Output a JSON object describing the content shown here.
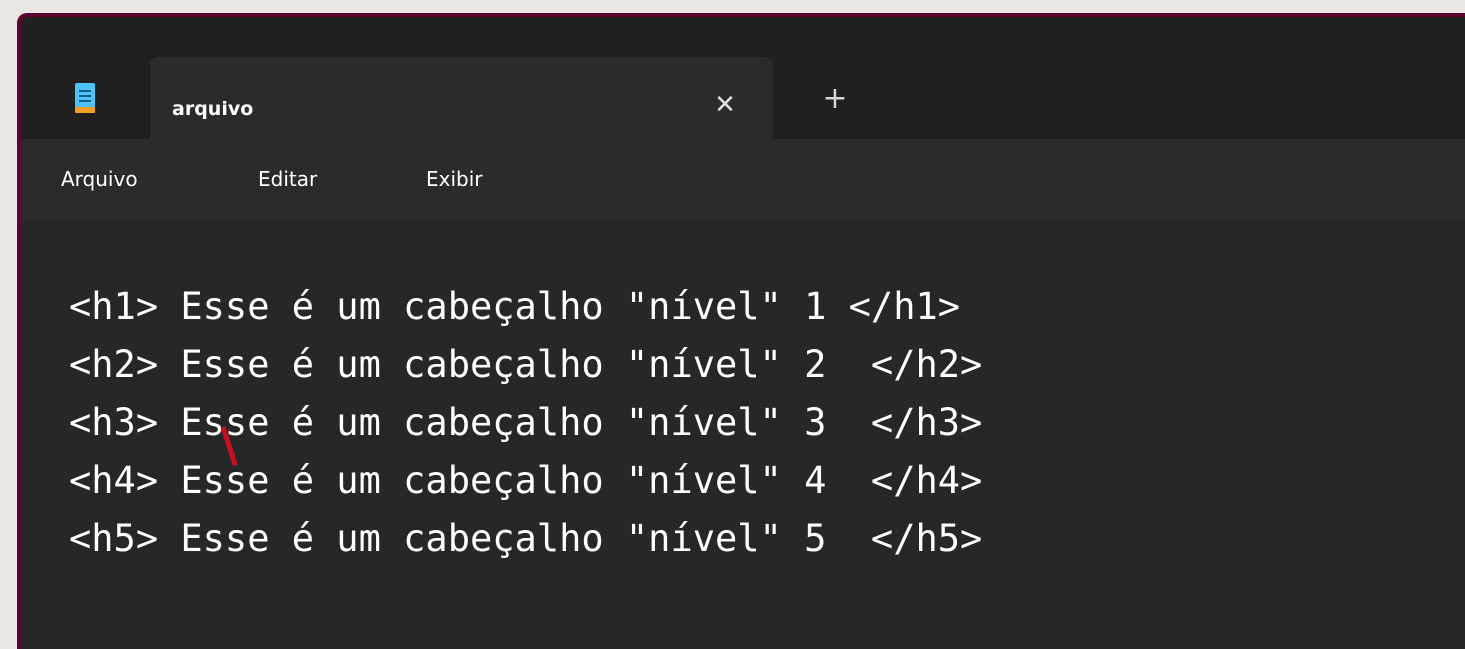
{
  "tab": {
    "title": "arquivo",
    "close_icon": "close-icon",
    "new_tab_icon": "plus-icon"
  },
  "menu": {
    "items": [
      "Arquivo",
      "Editar",
      "Exibir"
    ]
  },
  "editor": {
    "lines": [
      "<h1> Esse é um cabeçalho \"nível\" 1 </h1>",
      "<h2> Esse é um cabeçalho \"nível\" 2  </h2>",
      "<h3> Esse é um cabeçalho \"nível\" 3  </h3>",
      "<h4> Esse é um cabeçalho \"nível\" 4  </h4>",
      "<h5> Esse é um cabeçalho \"nível\" 5  </h5>"
    ]
  },
  "colors": {
    "window_border": "#5a0630",
    "titlebar_bg": "#202020",
    "tab_bg": "#2b2b2b",
    "editor_bg": "#272727",
    "text": "#ffffff",
    "notepad_icon": "#4cc2ff",
    "annotation_mark": "#c81020"
  }
}
